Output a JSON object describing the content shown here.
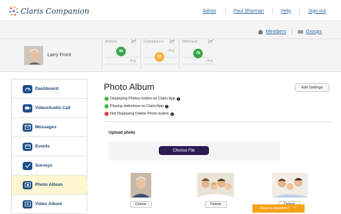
{
  "brand": {
    "name": "Claris Companion"
  },
  "top_nav": {
    "admin": "Admin",
    "user": "Paul Sharman",
    "help": "Help",
    "signout": "Sign out"
  },
  "sub_nav": {
    "members": "Members",
    "groups": "Groups"
  },
  "member": {
    "name": "Larry Front"
  },
  "metrics": [
    {
      "label": "Activity",
      "value": "96",
      "avg": "Avg",
      "color": "#3aa64a"
    },
    {
      "label": "Compliance",
      "value": "53",
      "avg": "Avg",
      "color": "#f4b13a"
    },
    {
      "label": "Wellness",
      "value": "78",
      "avg": "Avg",
      "color": "#3aa64a"
    }
  ],
  "sidebar": {
    "items": [
      {
        "label": "Dashboard",
        "icon": "dashboard-icon"
      },
      {
        "label": "Video/Audio Call",
        "icon": "video-call-icon"
      },
      {
        "label": "Messages",
        "icon": "messages-icon"
      },
      {
        "label": "Events",
        "icon": "events-icon"
      },
      {
        "label": "Surveys",
        "icon": "surveys-icon"
      },
      {
        "label": "Photo Album",
        "icon": "photo-album-icon",
        "active": true
      },
      {
        "label": "Video Album",
        "icon": "video-album-icon"
      }
    ]
  },
  "main": {
    "title": "Photo Album",
    "edit_settings": "Edit Settings",
    "statuses": [
      {
        "text": "Displaying Photos button on Claris App",
        "color": "#3cb84a"
      },
      {
        "text": "Playing slideshow on Claris App",
        "color": "#3cb84a"
      },
      {
        "text": "Not Displaying Delete Photo button",
        "color": "#e03b3b"
      }
    ],
    "info_glyph": "i",
    "upload_title": "Upload photo",
    "choose_file": "Choose File",
    "photos": [
      {
        "delete": "Delete"
      },
      {
        "delete": "Delete"
      },
      {
        "delete": "Delete"
      }
    ]
  },
  "help": {
    "question": "Have a question?",
    "chevron": "⌃"
  }
}
